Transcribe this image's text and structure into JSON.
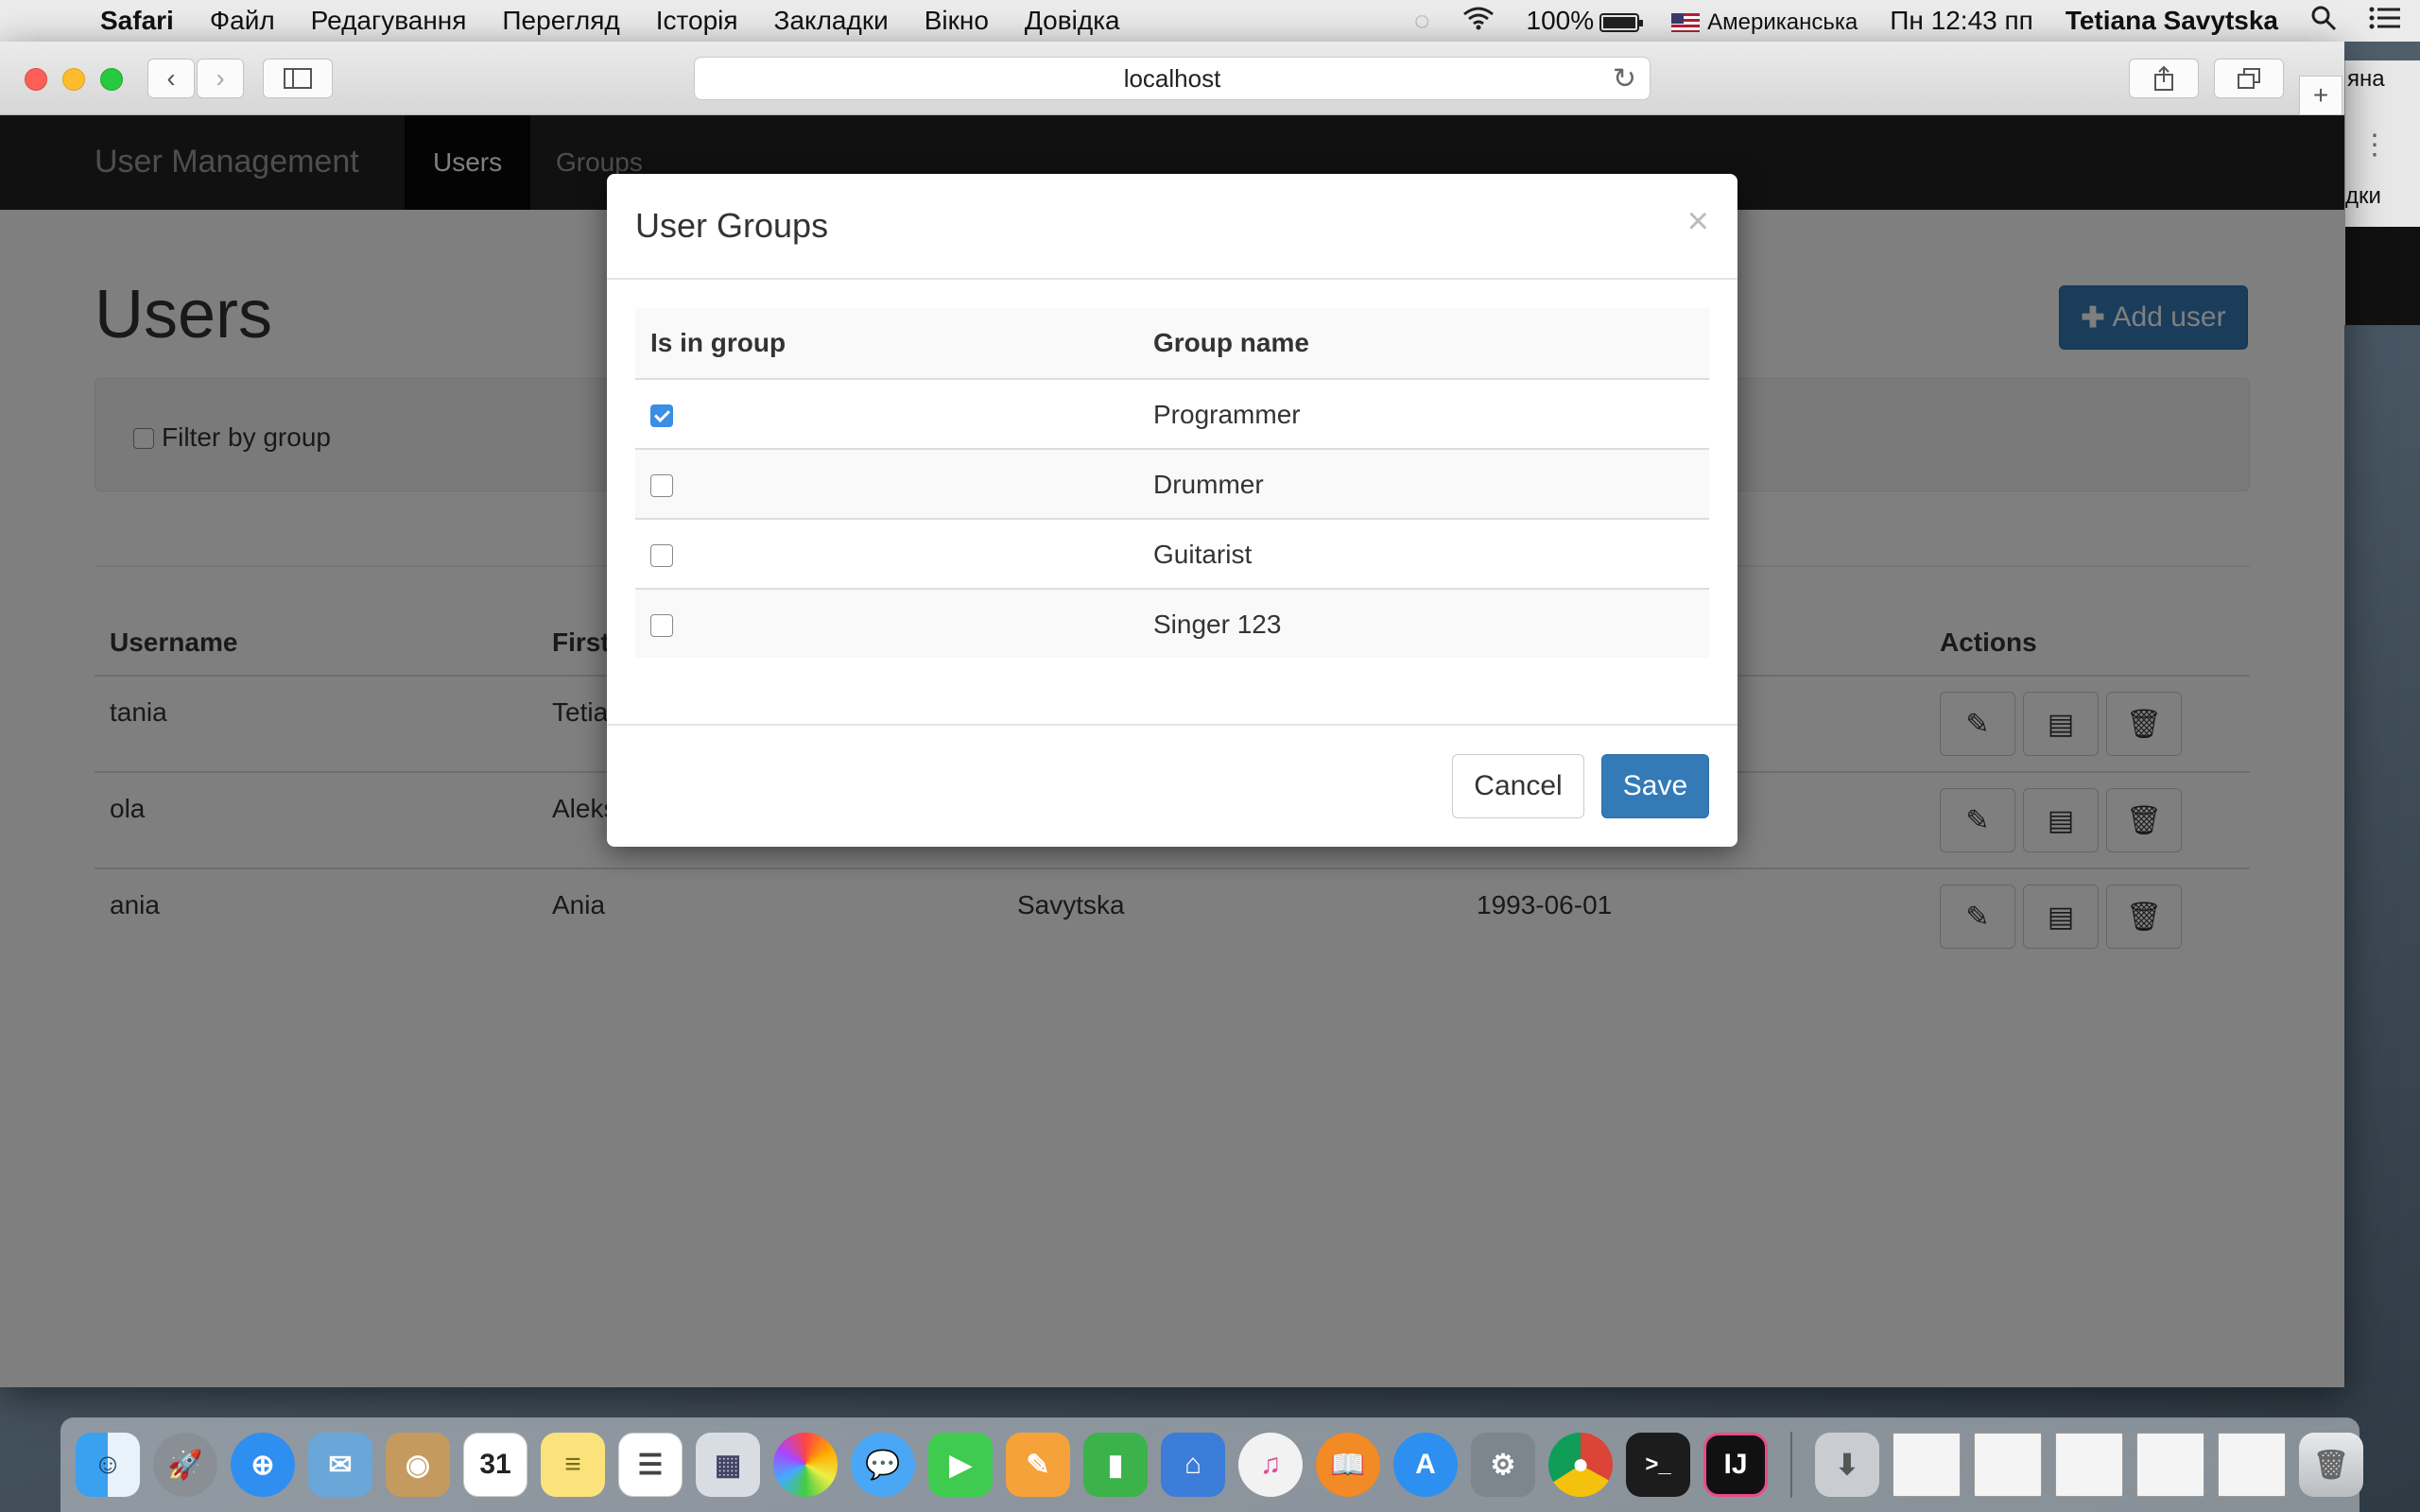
{
  "menubar": {
    "app": "Safari",
    "items": [
      "Файл",
      "Редагування",
      "Перегляд",
      "Історія",
      "Закладки",
      "Вікно",
      "Довідка"
    ],
    "battery": "100%",
    "input_source": "Американська",
    "clock": "Пн 12:43 пп",
    "user": "Tetiana Savytska"
  },
  "browser": {
    "address": "localhost"
  },
  "app": {
    "brand": "User Management",
    "nav": {
      "users": "Users",
      "groups": "Groups"
    },
    "title": "Users",
    "add_user": "Add user",
    "filter_label": "Filter by group",
    "table": {
      "headers": {
        "username": "Username",
        "first": "First",
        "actions": "Actions"
      },
      "rows": [
        {
          "username": "tania",
          "first": "Tetia",
          "last": "",
          "birth": ""
        },
        {
          "username": "ola",
          "first": "Aleks",
          "last": "",
          "birth": ""
        },
        {
          "username": "ania",
          "first": "Ania",
          "last": "Savytska",
          "birth": "1993-06-01"
        }
      ]
    }
  },
  "modal": {
    "title": "User Groups",
    "close": "×",
    "headers": {
      "in_group": "Is in group",
      "group_name": "Group name"
    },
    "groups": [
      {
        "name": "Programmer",
        "checked": true
      },
      {
        "name": "Drummer",
        "checked": false
      },
      {
        "name": "Guitarist",
        "checked": false
      },
      {
        "name": "Singer 123",
        "checked": false
      }
    ],
    "cancel": "Cancel",
    "save": "Save"
  },
  "bg_window": {
    "text_top": "яна",
    "text_mid": "дки"
  },
  "colors": {
    "primary": "#337ab7",
    "navbar": "#222222",
    "checkbox": "#3a8ee6"
  }
}
